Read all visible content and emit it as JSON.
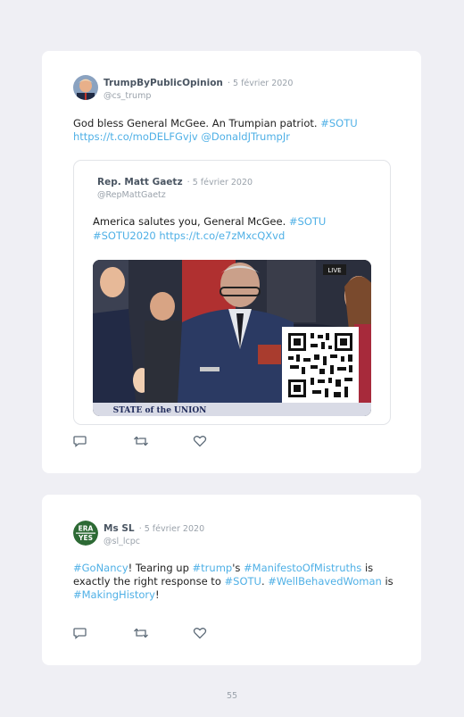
{
  "tweet1": {
    "author_name": "TrumpByPublicOpinion",
    "date": "· 5 février 2020",
    "handle": "@cs_trump",
    "text_plain": "God bless General McGee. An Trumpian patriot. ",
    "hashtag_sotu": "#SOTU",
    "link_url": "https://t.co/moDELFGvjv",
    "mention": "@DonaldJTrumpJr",
    "quote": {
      "author_name": "Rep. Matt Gaetz",
      "date": "· 5 février 2020",
      "handle": "@RepMattGaetz",
      "text_plain": "America salutes you, General McGee. ",
      "hashtag_sotu": "#SOTU",
      "hashtag_sotu2020": "#SOTU2020",
      "link_url": "https://t.co/e7zMxcQXvd",
      "media_live_badge": "LIVE",
      "media_banner": "STATE of the UNION"
    }
  },
  "tweet2": {
    "author_name": "Ms SL",
    "date": "· 5 février 2020",
    "handle": "@sl_lcpc",
    "avatar_text_top": "ERA",
    "avatar_text_bottom": "YES",
    "segments": {
      "s1": "#GoNancy",
      "s2": "! Tearing up ",
      "s3": "#trump",
      "s4": "'s ",
      "s5": "#ManifestoOfMistruths",
      "s6": " is exactly the right response to ",
      "s7": "#SOTU",
      "s8": ". ",
      "s9": "#WellBehavedWoman",
      "s10": " is ",
      "s11": "#MakingHistory",
      "s12": "!"
    }
  },
  "page_number": "55",
  "colors": {
    "link": "#4fb0e6",
    "meta": "#9aa2ab",
    "name": "#4a5562",
    "background": "#efeff4"
  }
}
